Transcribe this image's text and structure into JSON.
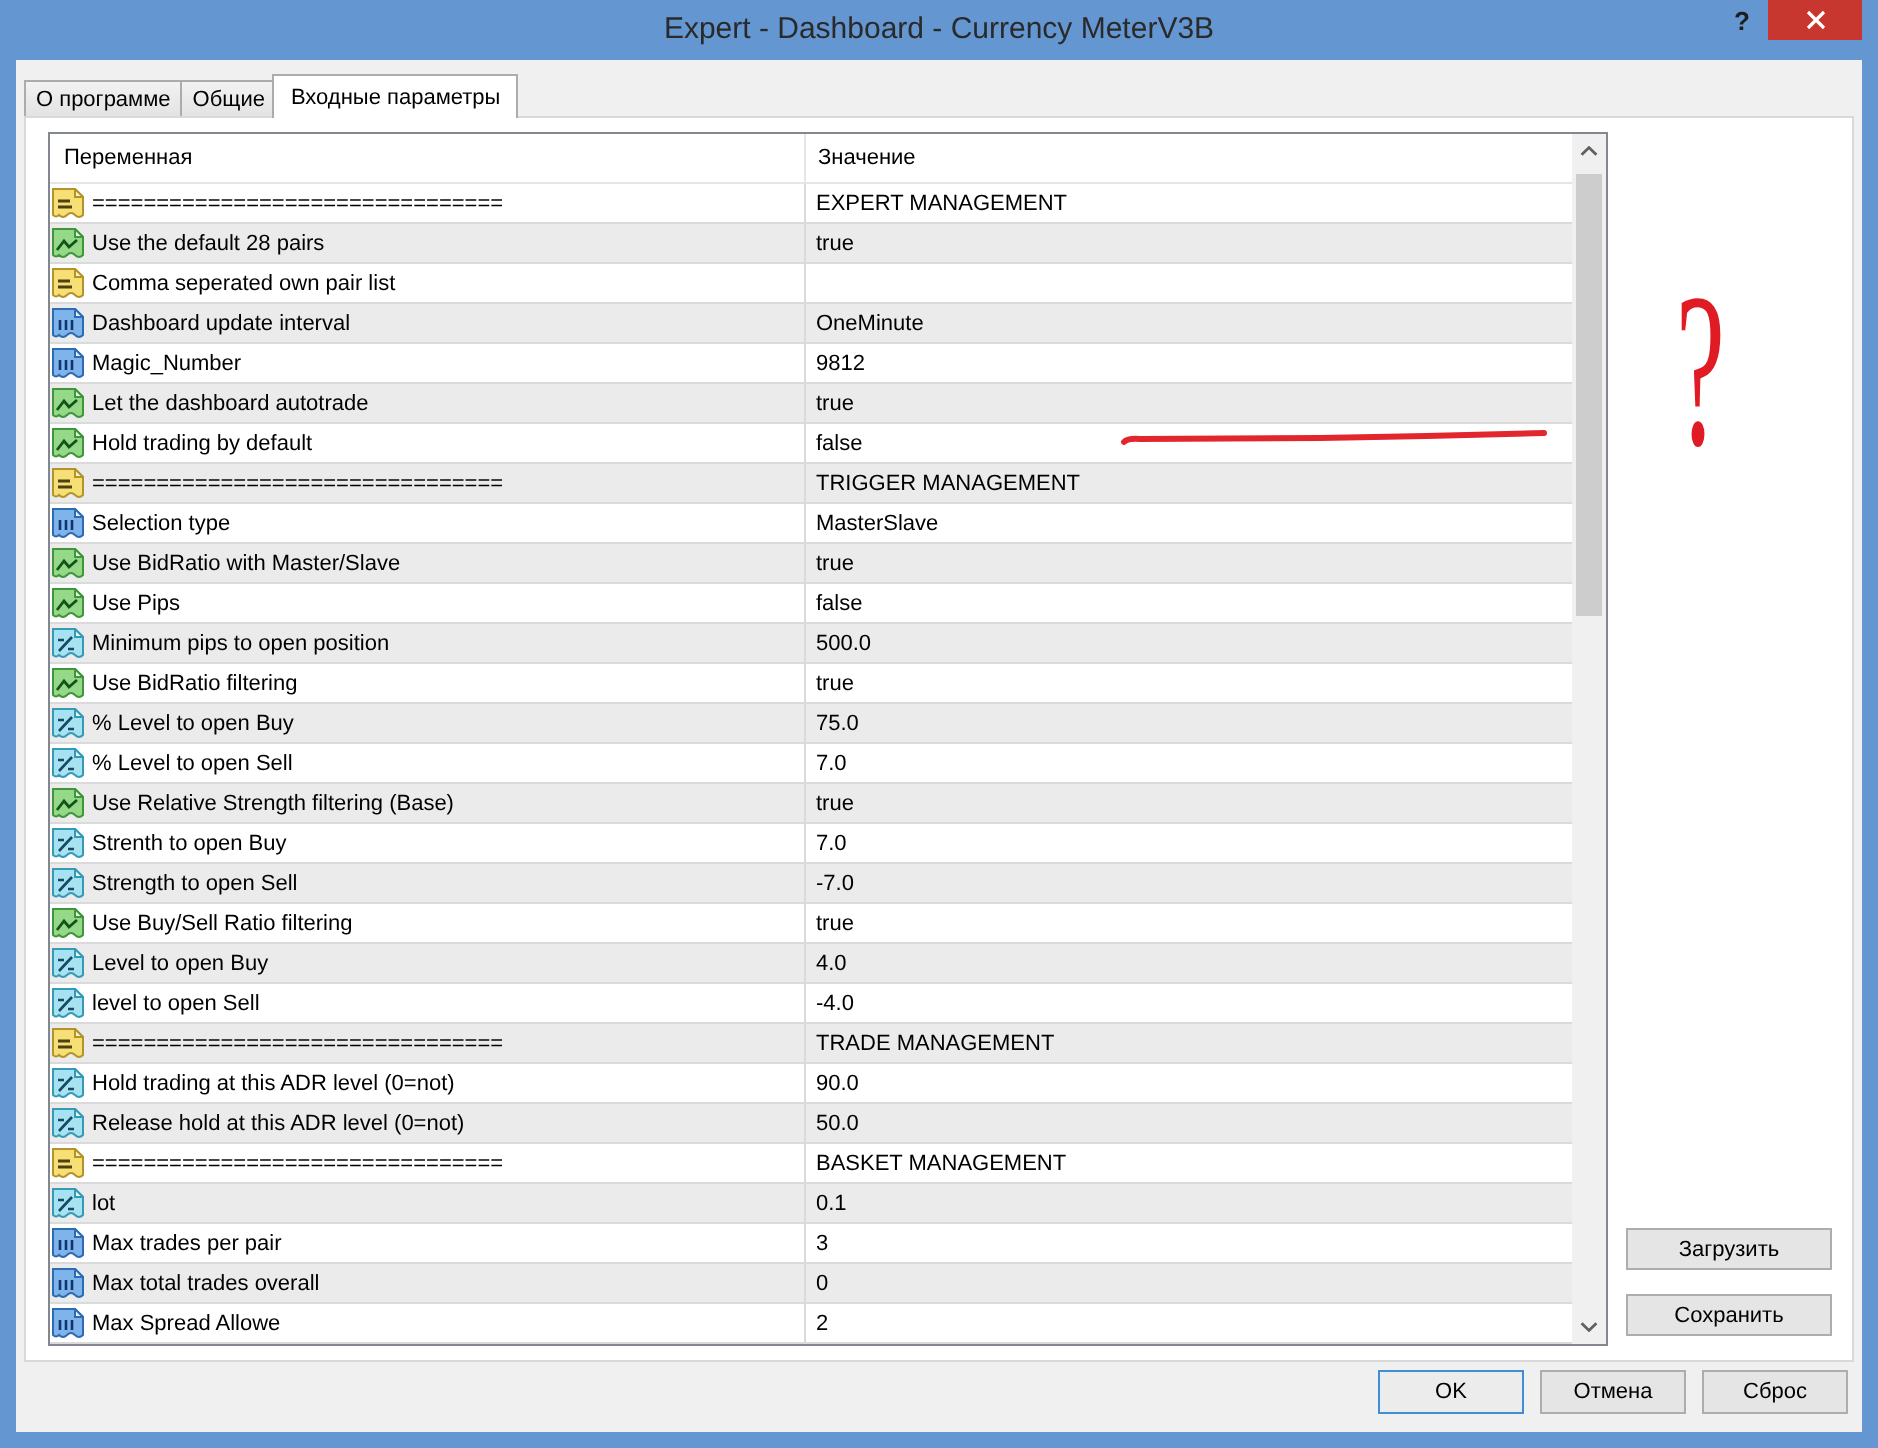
{
  "window": {
    "title": "Expert - Dashboard - Currency MeterV3B",
    "help_button": "?"
  },
  "tabs": [
    {
      "label": "О программе",
      "selected": false
    },
    {
      "label": "Общие",
      "selected": false
    },
    {
      "label": "Входные параметры",
      "selected": true
    }
  ],
  "table": {
    "columns": [
      "Переменная",
      "Значение"
    ],
    "rows": [
      {
        "kind": "string",
        "name": "================================",
        "value": "EXPERT MANAGEMENT"
      },
      {
        "kind": "bool",
        "name": "Use the default 28 pairs",
        "value": "true"
      },
      {
        "kind": "string",
        "name": "Comma seperated own pair list"
      },
      {
        "kind": "int",
        "name": "Dashboard update interval",
        "value": "OneMinute"
      },
      {
        "kind": "int",
        "name": "Magic_Number",
        "value": "9812"
      },
      {
        "kind": "bool",
        "name": "Let the dashboard autotrade",
        "value": "true"
      },
      {
        "kind": "bool",
        "name": "Hold trading by default",
        "value": "false"
      },
      {
        "kind": "string",
        "name": "================================",
        "value": "TRIGGER MANAGEMENT"
      },
      {
        "kind": "int",
        "name": "Selection type",
        "value": "MasterSlave"
      },
      {
        "kind": "bool",
        "name": "Use BidRatio with Master/Slave",
        "value": "true"
      },
      {
        "kind": "bool",
        "name": "Use Pips",
        "value": "false"
      },
      {
        "kind": "double",
        "name": "Minimum pips to open position",
        "value": "500.0"
      },
      {
        "kind": "bool",
        "name": "Use BidRatio filtering",
        "value": "true"
      },
      {
        "kind": "double",
        "name": "% Level to open Buy",
        "value": "75.0"
      },
      {
        "kind": "double",
        "name": "% Level to open Sell",
        "value": "7.0"
      },
      {
        "kind": "bool",
        "name": "Use Relative Strength filtering (Base)",
        "value": "true"
      },
      {
        "kind": "double",
        "name": "Strenth to open Buy",
        "value": "7.0"
      },
      {
        "kind": "double",
        "name": "Strength to open Sell",
        "value": "-7.0"
      },
      {
        "kind": "bool",
        "name": "Use Buy/Sell Ratio filtering",
        "value": "true"
      },
      {
        "kind": "double",
        "name": "Level to open Buy",
        "value": "4.0"
      },
      {
        "kind": "double",
        "name": "level to open Sell",
        "value": "-4.0"
      },
      {
        "kind": "string",
        "name": "================================",
        "value": "TRADE MANAGEMENT"
      },
      {
        "kind": "double",
        "name": "Hold trading at this ADR level (0=not)",
        "value": "90.0"
      },
      {
        "kind": "double",
        "name": "Release hold at this ADR level (0=not)",
        "value": "50.0"
      },
      {
        "kind": "string",
        "name": "================================",
        "value": "BASKET MANAGEMENT"
      },
      {
        "kind": "double",
        "name": "lot",
        "value": "0.1"
      },
      {
        "kind": "int",
        "name": "Max trades per pair",
        "value": "3"
      },
      {
        "kind": "int",
        "name": "Max total trades overall",
        "value": "0"
      },
      {
        "kind": "int",
        "name": "Max Spread Allowe",
        "value": "2"
      }
    ]
  },
  "annotation": {
    "text": "?"
  },
  "side_buttons": [
    "Загрузить",
    "Сохранить"
  ],
  "dialog_buttons": [
    {
      "label": "OK",
      "default": true
    },
    {
      "label": "Отмена",
      "default": false
    },
    {
      "label": "Сброс",
      "default": false
    }
  ]
}
